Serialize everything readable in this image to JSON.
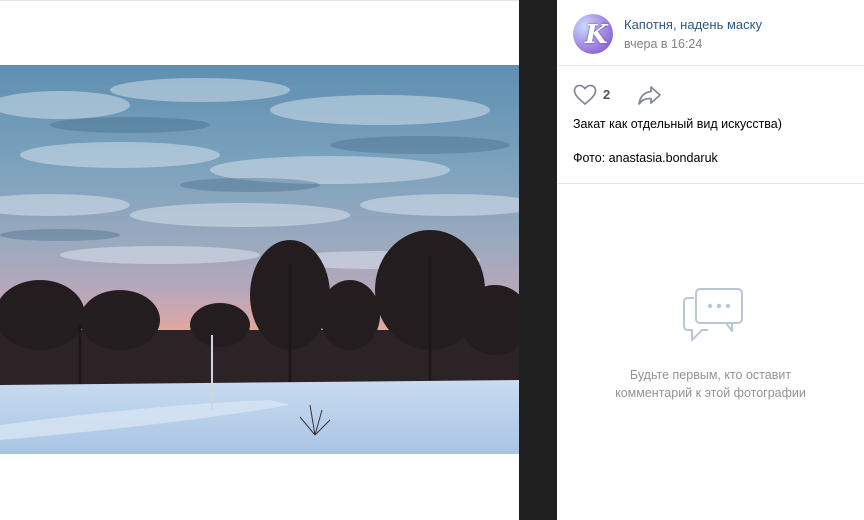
{
  "post": {
    "author": "Капотня, надень маску",
    "time": "вчера в 16:24",
    "avatar_letter": "K",
    "likes": "2",
    "caption": "Закат как отдельный вид искусства)",
    "credit": "Фото: anastasia.bondaruk"
  },
  "comments": {
    "empty_line1": "Будьте первым, кто оставит",
    "empty_line2": "комментарий к этой фотографии"
  },
  "icons": {
    "like": "heart-icon",
    "share": "share-arrow-icon",
    "comments": "speech-bubbles-icon"
  },
  "colors": {
    "link": "#2a5885",
    "muted": "#828282",
    "placeholder": "#939393",
    "icon": "#99a2ad",
    "dark_divider": "#1f1f1f"
  }
}
